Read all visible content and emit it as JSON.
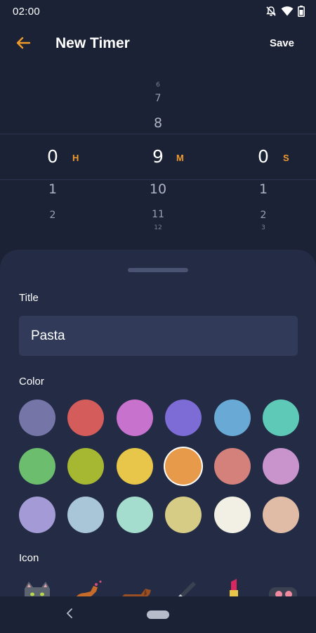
{
  "status_bar": {
    "time": "02:00",
    "icons": [
      "notifications-off-icon",
      "wifi-icon",
      "battery-icon"
    ]
  },
  "app_bar": {
    "title": "New Timer",
    "save_label": "Save",
    "back_icon": "arrow-left-icon",
    "accent": "#ee9a2c"
  },
  "picker": {
    "hours": {
      "above": [
        "",
        "",
        ""
      ],
      "selected": "0",
      "below": [
        "1",
        "2",
        ""
      ],
      "unit": "H"
    },
    "minutes": {
      "above": [
        "6",
        "7",
        "8"
      ],
      "selected": "9",
      "below": [
        "10",
        "11",
        "12"
      ],
      "unit": "M"
    },
    "seconds": {
      "above": [
        "",
        "",
        ""
      ],
      "selected": "0",
      "below": [
        "1",
        "2",
        "3"
      ],
      "unit": "S"
    }
  },
  "form": {
    "title_label": "Title",
    "title_value": "Pasta",
    "color_label": "Color",
    "icon_label": "Icon",
    "selected_color": "#e89a4b",
    "colors": [
      "#7575a8",
      "#d45c5a",
      "#c772cc",
      "#7d6bd6",
      "#69a9d6",
      "#5ec9b7",
      "#6cbd6e",
      "#a6b832",
      "#e8c64a",
      "#e89a4b",
      "#d4817c",
      "#c994cc",
      "#a49bd6",
      "#a9c6d9",
      "#a4dccd",
      "#d6cc86",
      "#f2f0e4",
      "#e0bca6"
    ],
    "icons": [
      "cat-icon",
      "dog-running-icon",
      "dachshund-icon",
      "brush-icon",
      "lipstick-icon",
      "gamepad-icon"
    ]
  },
  "nav_bar": {
    "back_icon": "nav-back-icon",
    "home_icon": "nav-home-pill"
  }
}
